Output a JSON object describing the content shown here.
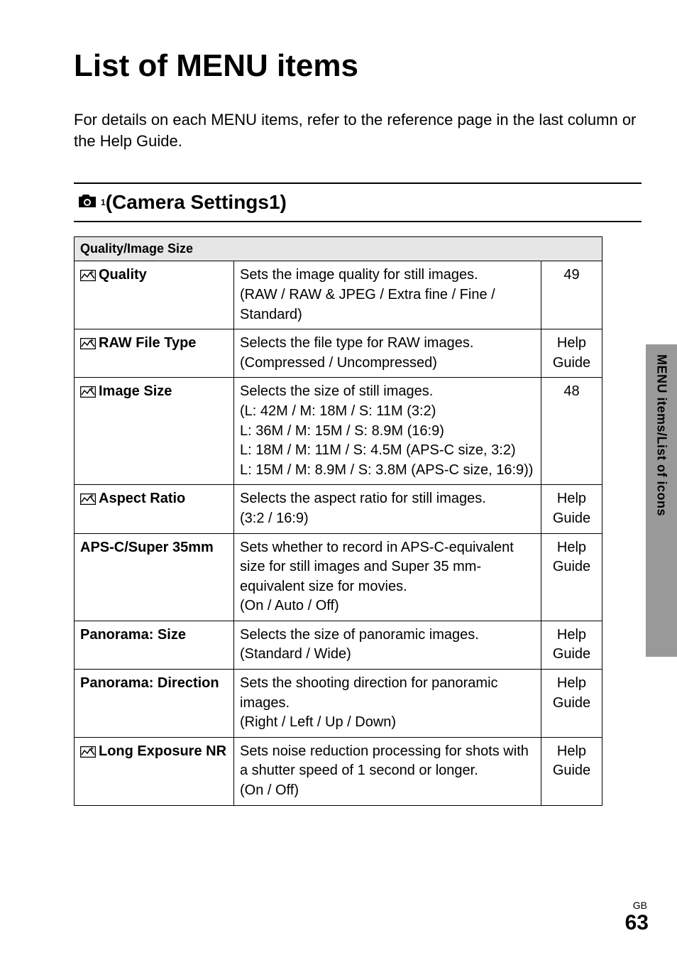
{
  "title": "List of MENU items",
  "intro": "For details on each MENU items, refer to the reference page in the last column or the Help Guide.",
  "section": {
    "icon_sub": "1",
    "title": "(Camera Settings1)"
  },
  "table": {
    "group_header": "Quality/Image Size",
    "rows": [
      {
        "has_icon": true,
        "name": "Quality",
        "desc": "Sets the image quality for still images.\n(RAW / RAW & JPEG / Extra fine / Fine / Standard)",
        "ref": "49"
      },
      {
        "has_icon": true,
        "name": "RAW File Type",
        "desc": "Selects the file type for RAW images.\n(Compressed / Uncompressed)",
        "ref": "Help\nGuide"
      },
      {
        "has_icon": true,
        "name": "Image Size",
        "desc": "Selects the size of still images.\n(L:  42M / M:  18M / S:  11M (3:2)\nL:  36M / M:  15M / S:  8.9M (16:9)\nL:  18M / M:  11M / S:  4.5M (APS-C size, 3:2)\nL:  15M / M:  8.9M / S:  3.8M (APS-C size, 16:9))",
        "ref": "48"
      },
      {
        "has_icon": true,
        "name": "Aspect Ratio",
        "desc": "Selects the aspect ratio for still images.\n(3:2 / 16:9)",
        "ref": "Help\nGuide"
      },
      {
        "has_icon": false,
        "name": "APS-C/Super 35mm",
        "desc": "Sets whether to record in APS-C-equivalent size for still images and Super 35 mm-equivalent size for movies.\n(On / Auto / Off)",
        "ref": "Help\nGuide"
      },
      {
        "has_icon": false,
        "name": "Panorama: Size",
        "desc": "Selects the size of panoramic images.\n(Standard / Wide)",
        "ref": "Help\nGuide"
      },
      {
        "has_icon": false,
        "name": "Panorama: Direction",
        "desc": "Sets the shooting direction for panoramic images.\n(Right / Left / Up / Down)",
        "ref": "Help\nGuide"
      },
      {
        "has_icon": true,
        "name": "Long Exposure NR",
        "desc": "Sets noise reduction processing for shots with a shutter speed of 1 second or longer.\n(On / Off)",
        "ref": "Help\nGuide"
      }
    ]
  },
  "side_tab": "MENU items/List of icons",
  "footer": {
    "lang": "GB",
    "page": "63"
  }
}
